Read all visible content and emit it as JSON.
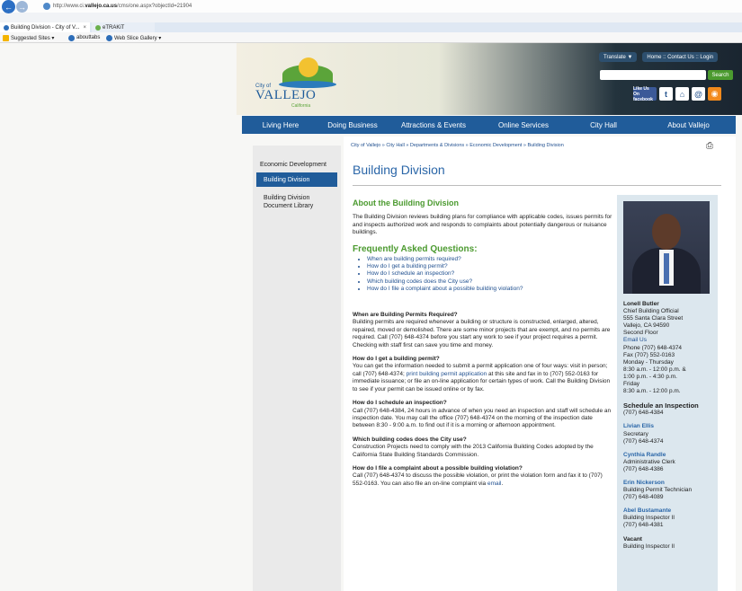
{
  "browser": {
    "url_prefix": "http://www.ci.",
    "url_domain": "vallejo.ca.us",
    "url_suffix": "/cms/one.aspx?objectId=21904",
    "tabs": [
      {
        "label": "Building Division - City of V...",
        "close": "×"
      },
      {
        "label": "eTRAKiT"
      }
    ],
    "favorites": [
      "Suggested Sites ▾",
      "abouttabs",
      "Web Slice Gallery ▾"
    ]
  },
  "header": {
    "logo": {
      "city": "City of",
      "name": "VALLEJO",
      "state": "California"
    },
    "translate": "Translate ▼",
    "top_links": "Home :: Contact Us :: Login",
    "search_placeholder": "",
    "search_button": "Search",
    "social": {
      "facebook": "Like Us On facebook",
      "icons": [
        "twitter-icon",
        "home-icon",
        "email-icon",
        "rss-icon"
      ]
    }
  },
  "nav": [
    "Living Here",
    "Doing Business",
    "Attractions & Events",
    "Online Services",
    "City Hall",
    "About Vallejo"
  ],
  "sidebar": {
    "title": "Economic Development",
    "active": "Building Division",
    "items": [
      "Building Division Document Library"
    ]
  },
  "main": {
    "breadcrumb": "City of Vallejo » City Hall » Departments & Divisions » Economic Development » Building Division",
    "title": "Building Division",
    "about_heading": "About the Building Division",
    "about_text": "The Building Division reviews building plans for compliance with applicable codes, issues permits for and inspects authorized work and responds to complaints about potentially dangerous or nuisance buildings.",
    "faq_heading": "Frequently Asked Questions:",
    "faq_links": [
      "When are building permits required?",
      "How do I get a building permit?",
      "How do I schedule an inspection?",
      "Which building codes does the City use?",
      "How do I file a complaint about a possible building violation?"
    ],
    "qa": [
      {
        "q": "When are Building Permits Required?",
        "a": "Building permits are required whenever a building or structure is constructed, enlarged, altered, repaired, moved or demolished. There are some minor projects that are exempt, and no permits are required. Call (707) 648-4374 before you start any work to see if your project requires a permit. Checking with staff first can save you time and money."
      },
      {
        "q": "How do I get a building permit?",
        "a_pre": "You can get the information needed to submit a permit application one of four ways: visit in person; call (707) 648-4374; ",
        "a_link": "print building permit application",
        "a_post": " at this site and fax in to (707) 552-0163 for immediate issuance; or file an on-line application for certain types of work. Call the Building Division to see if your permit can be issued online or by fax."
      },
      {
        "q": "How do I schedule an inspection?",
        "a": "Call (707) 648-4384, 24 hours in advance of when you need an inspection and staff will schedule an inspection date. You may call the office (707) 648-4374 on the morning of the inspection date between 8:30 - 9:00 a.m. to find out if it is a morning or afternoon appointment."
      },
      {
        "q": "Which building codes does the City use?",
        "a": "Construction Projects need to comply with the 2013 California Building Codes adopted by the California State Building Standards Commission."
      },
      {
        "q": "How do I file a complaint about a possible building violation?",
        "a_pre": "Call (707) 648-4374 to discuss the possible violation, or print the violation form and fax it to (707) 552-0163. You can also file an on-line complaint via ",
        "a_link": "email",
        "a_post": "."
      }
    ]
  },
  "staff": {
    "chief": {
      "name": "Lonell Butler",
      "title": "Chief Building Official",
      "address1": "555 Santa Clara Street",
      "address2": "Vallejo, CA 94590",
      "address3": "Second Floor",
      "email": "Email Us",
      "phone": "Phone (707) 648-4374",
      "fax": "Fax (707) 552-0163",
      "hours1": "Monday - Thursday",
      "hours2": "8:30 a.m. - 12:00 p.m. &",
      "hours3": "1:00 p.m. - 4:30 p.m.",
      "hours4": "Friday",
      "hours5": "8:30 a.m. - 12:00 p.m."
    },
    "schedule_heading": "Schedule an Inspection",
    "schedule_phone": "(707) 648-4384",
    "people": [
      {
        "name": "Livian Ellis",
        "title": "Secretary",
        "phone": "(707) 648-4374"
      },
      {
        "name": "Cynthia Randle",
        "title": "Administrative Clerk",
        "phone": "(707) 648-4386"
      },
      {
        "name": "Erin Nickerson",
        "title": "Building Permit Technician",
        "phone": "(707) 648-4089"
      },
      {
        "name": "Abel Bustamante",
        "title": "Building Inspector II",
        "phone": "(707) 648-4381"
      },
      {
        "name": "Vacant",
        "title": "Building Inspector II"
      }
    ]
  }
}
